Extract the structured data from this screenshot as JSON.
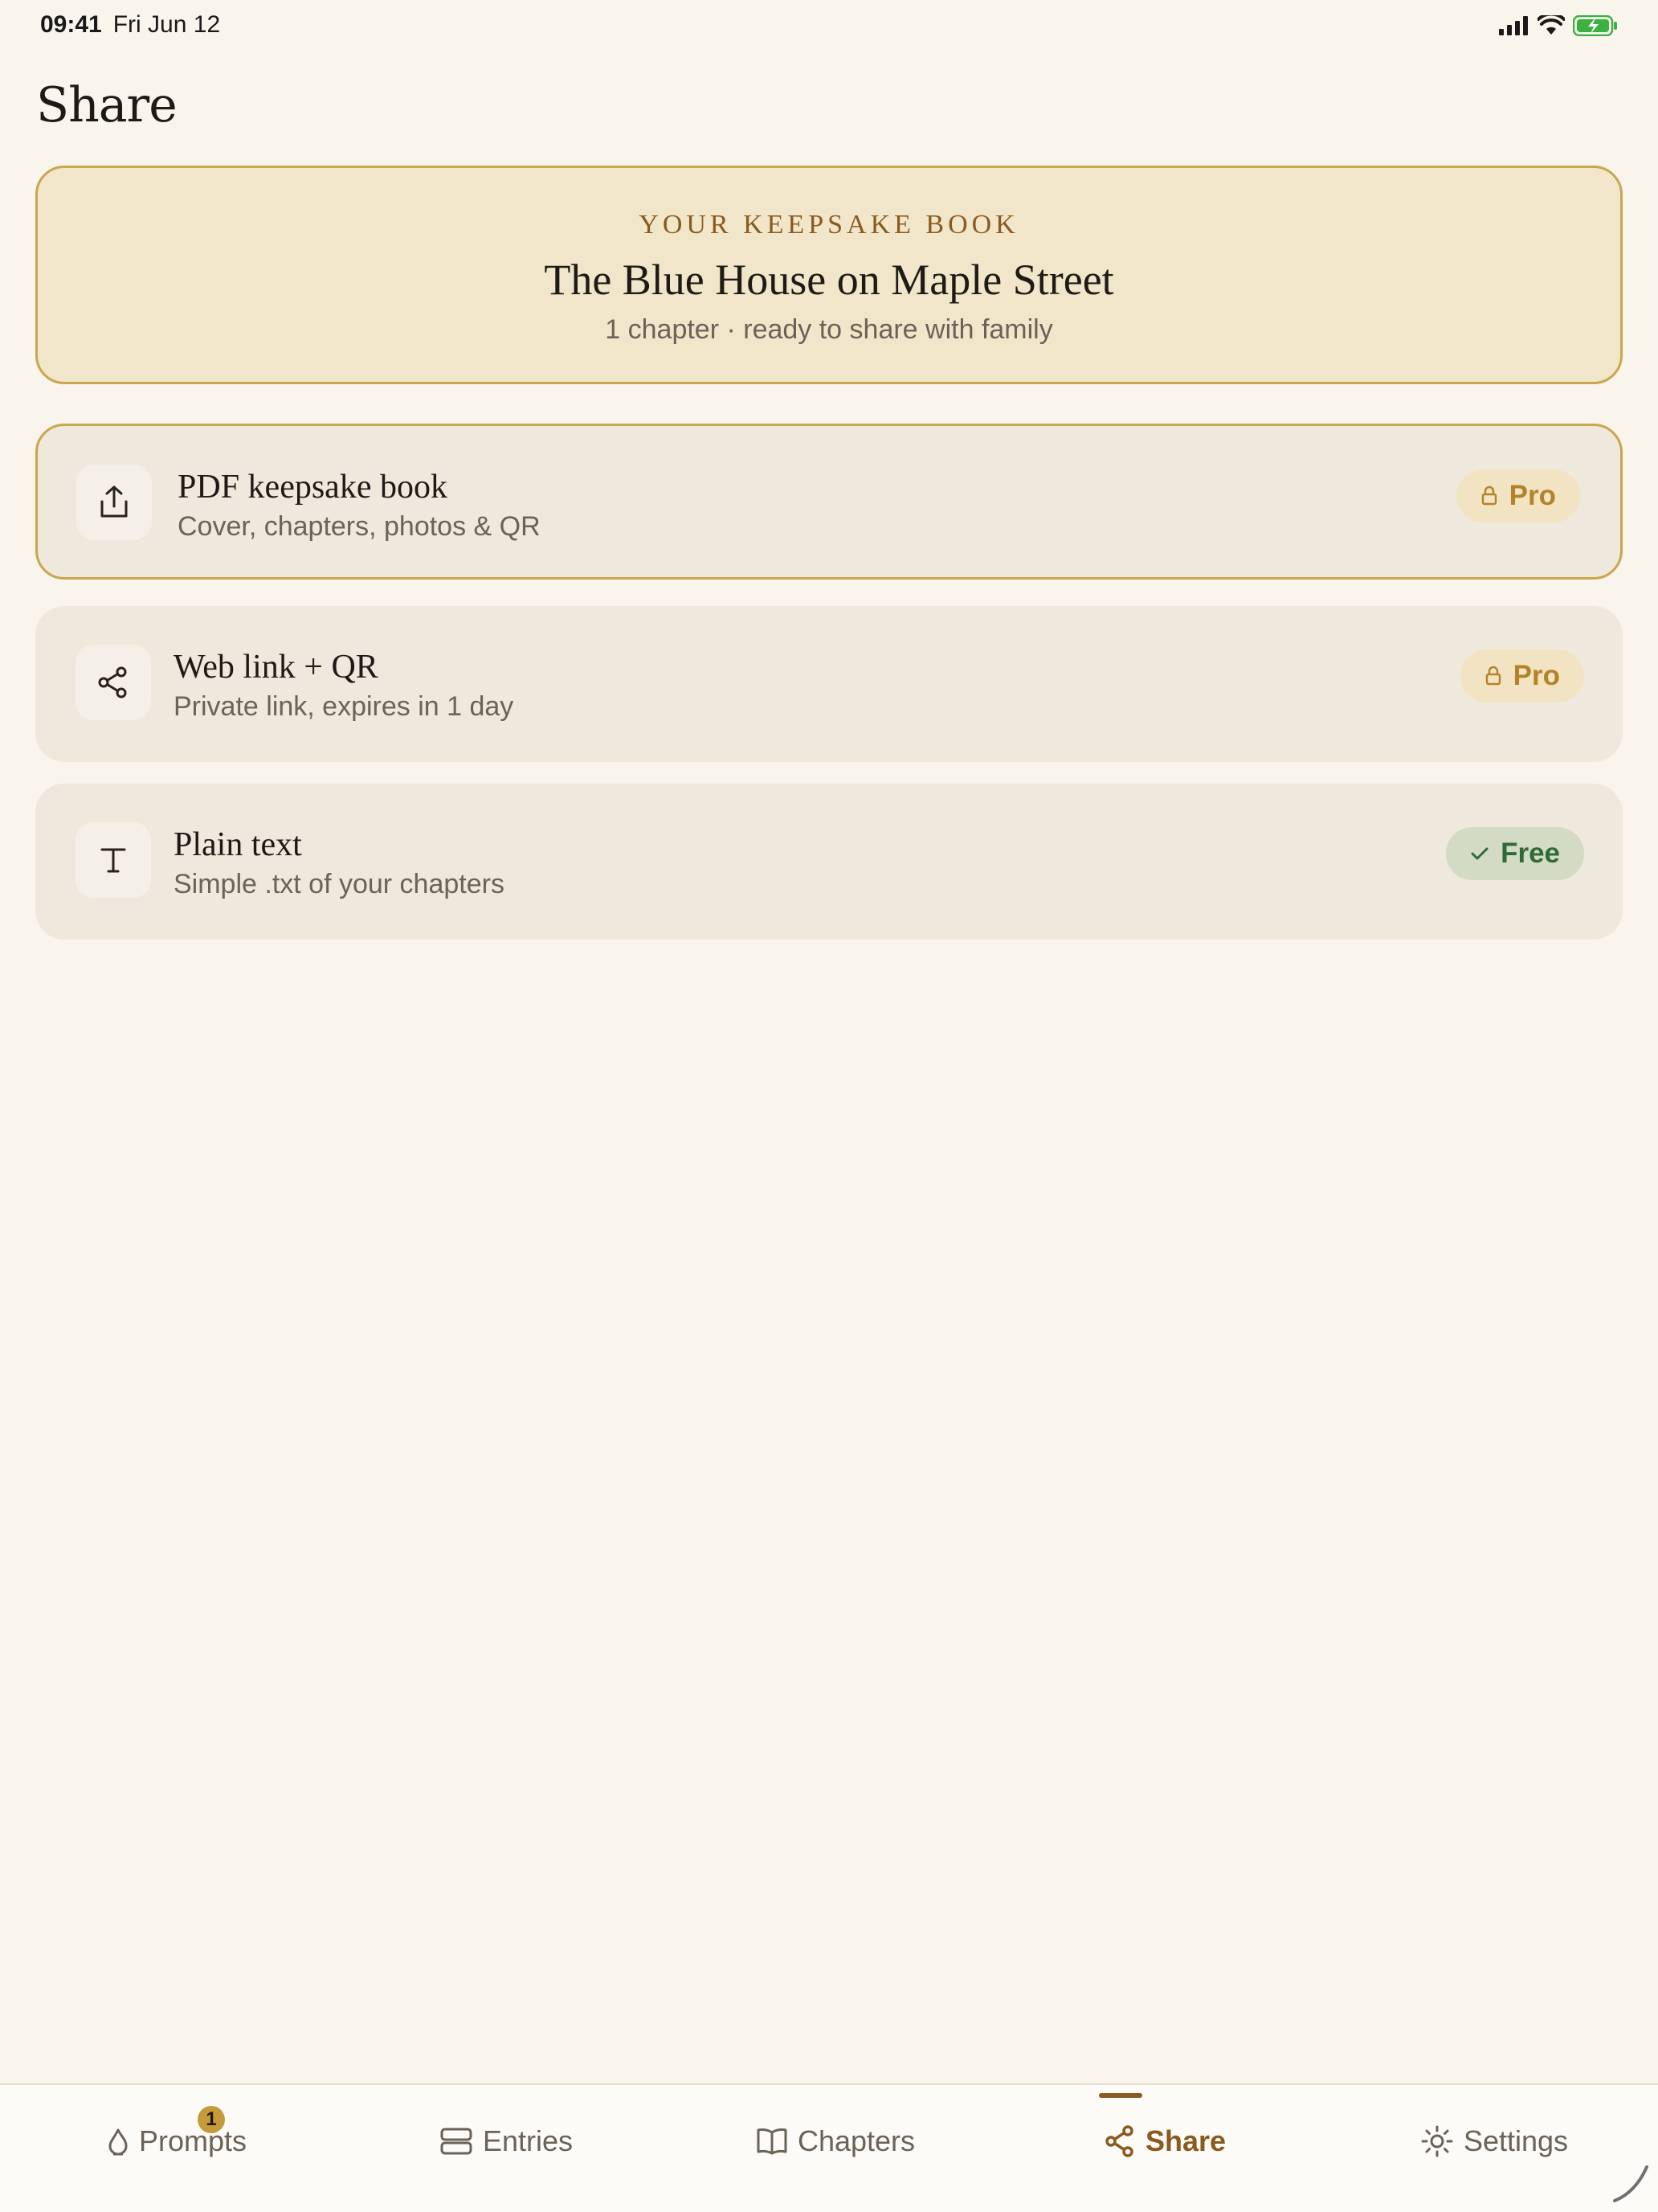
{
  "status": {
    "time": "09:41",
    "date": "Fri Jun 12"
  },
  "page": {
    "title": "Share"
  },
  "hero": {
    "kicker": "YOUR KEEPSAKE BOOK",
    "title": "The Blue House on Maple Street",
    "subtitle": "1 chapter · ready to share with family"
  },
  "options": [
    {
      "title": "PDF keepsake book",
      "subtitle": "Cover, chapters, photos & QR",
      "badge": "Pro",
      "icon": "share-export-icon"
    },
    {
      "title": "Web link + QR",
      "subtitle": "Private link, expires in 1 day",
      "badge": "Pro",
      "icon": "share-nodes-icon"
    },
    {
      "title": "Plain text",
      "subtitle": "Simple .txt of your chapters",
      "badge": "Free",
      "icon": "text-icon"
    }
  ],
  "tabs": [
    {
      "label": "Prompts",
      "icon": "flame-icon",
      "badge": "1"
    },
    {
      "label": "Entries",
      "icon": "stack-icon"
    },
    {
      "label": "Chapters",
      "icon": "book-icon"
    },
    {
      "label": "Share",
      "icon": "share-nodes-icon",
      "active": true
    },
    {
      "label": "Settings",
      "icon": "sun-gear-icon"
    }
  ],
  "colors": {
    "background": "#f9f4ec",
    "accent": "#8a5a1f",
    "gold": "#c9a74e",
    "pro": "#b3832a",
    "free": "#2f6b35"
  }
}
